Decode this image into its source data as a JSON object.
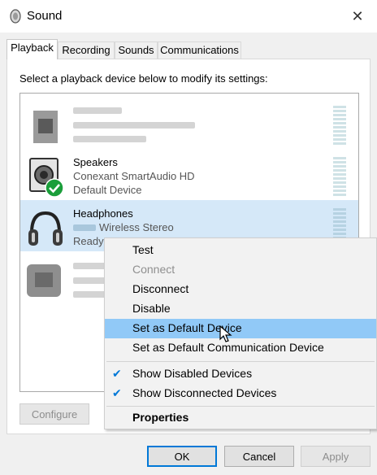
{
  "window": {
    "title": "Sound",
    "close_symbol": "✕"
  },
  "tabs": [
    {
      "label": "Playback"
    },
    {
      "label": "Recording"
    },
    {
      "label": "Sounds"
    },
    {
      "label": "Communications"
    }
  ],
  "instruction": "Select a playback device below to modify its settings:",
  "devices": [
    {
      "name": "Speakers",
      "description": "Conexant SmartAudio HD",
      "status": "Default Device"
    },
    {
      "name": "Headphones",
      "description": "Wireless Stereo",
      "status": "Ready"
    }
  ],
  "context_menu": {
    "items": [
      {
        "label": "Test"
      },
      {
        "label": "Connect"
      },
      {
        "label": "Disconnect"
      },
      {
        "label": "Disable"
      },
      {
        "label": "Set as Default Device"
      },
      {
        "label": "Set as Default Communication Device"
      },
      {
        "label": "Show Disabled Devices"
      },
      {
        "label": "Show Disconnected Devices"
      },
      {
        "label": "Properties"
      }
    ],
    "check_symbol": "✔"
  },
  "buttons": {
    "configure": "Configure",
    "ok": "OK",
    "cancel": "Cancel",
    "apply": "Apply"
  },
  "colors": {
    "selection": "#d5e8f8",
    "menu_highlight": "#91c9f7",
    "default_badge": "#1a9e3a",
    "accent": "#0078d7"
  }
}
